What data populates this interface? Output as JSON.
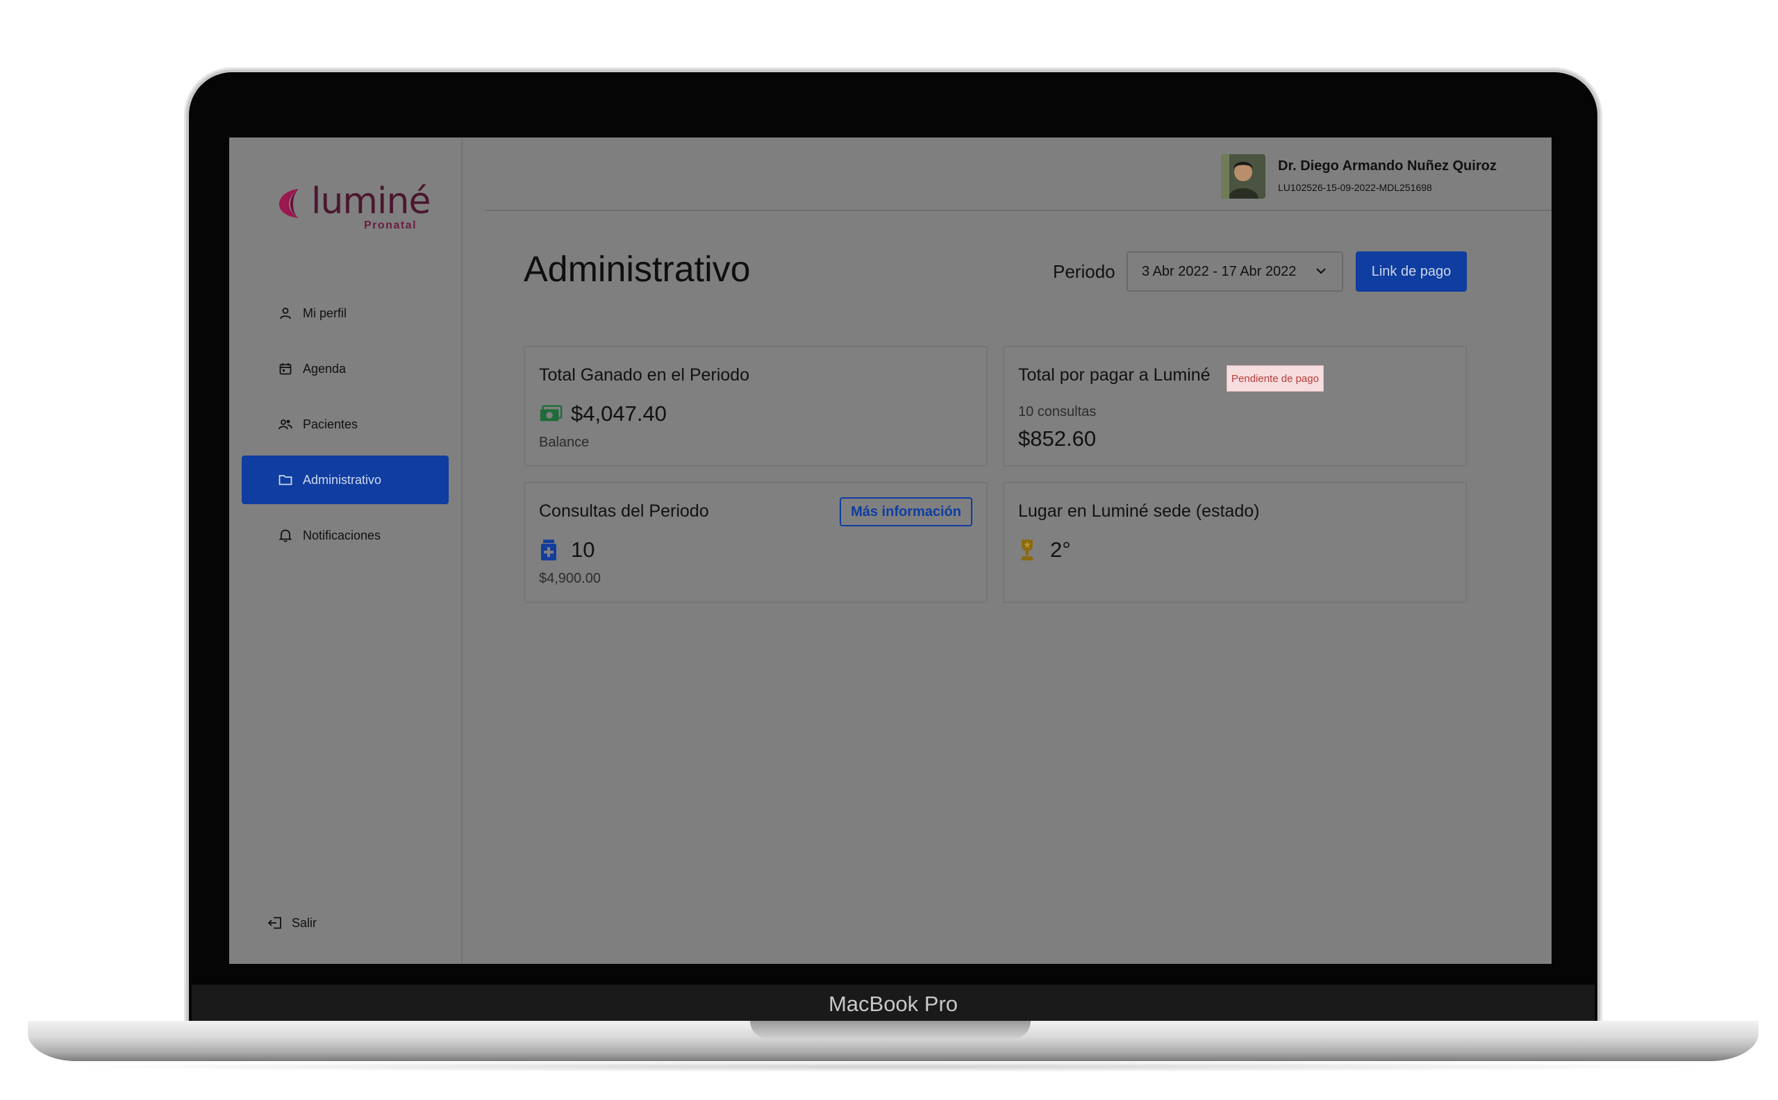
{
  "device": {
    "brand_label": "MacBook Pro"
  },
  "logo": {
    "name": "luminé",
    "subtitle": "Pronatal"
  },
  "sidebar": {
    "items": [
      {
        "label": "Mi perfil",
        "icon": "user-icon",
        "active": false
      },
      {
        "label": "Agenda",
        "icon": "calendar-icon",
        "active": false
      },
      {
        "label": "Pacientes",
        "icon": "users-icon",
        "active": false
      },
      {
        "label": "Administrativo",
        "icon": "folder-icon",
        "active": true
      },
      {
        "label": "Notificaciones",
        "icon": "bell-icon",
        "active": false
      }
    ],
    "logout_label": "Salir"
  },
  "user": {
    "name": "Dr. Diego Armando Nuñez Quiroz",
    "id": "LU102526-15-09-2022-MDL251698"
  },
  "page": {
    "title": "Administrativo",
    "period_label": "Periodo",
    "period_value": "3 Abr 2022 - 17 Abr 2022",
    "pay_link_label": "Link de pago"
  },
  "cards": {
    "earned": {
      "title": "Total Ganado en el Periodo",
      "amount": "$4,047.40",
      "caption": "Balance",
      "icon": "money-icon"
    },
    "to_pay": {
      "title": "Total por pagar a Luminé",
      "badge": "Pendiente de pago",
      "count": "10 consultas",
      "amount": "$852.60"
    },
    "consults": {
      "title": "Consultas del Periodo",
      "more_label": "Más información",
      "count": "10",
      "amount": "$4,900.00",
      "icon": "medical-icon"
    },
    "rank": {
      "title": "Lugar en Luminé sede (estado)",
      "value": "2°",
      "icon": "trophy-icon"
    }
  },
  "colors": {
    "accent": "#0f3da0",
    "earned_icon": "#1f6b3a",
    "medical_icon": "#143e9c",
    "trophy_icon": "#8a6a12",
    "badge_bg": "#f7dede",
    "badge_text": "#b83a3a",
    "logo_mark": "#a0154f"
  }
}
